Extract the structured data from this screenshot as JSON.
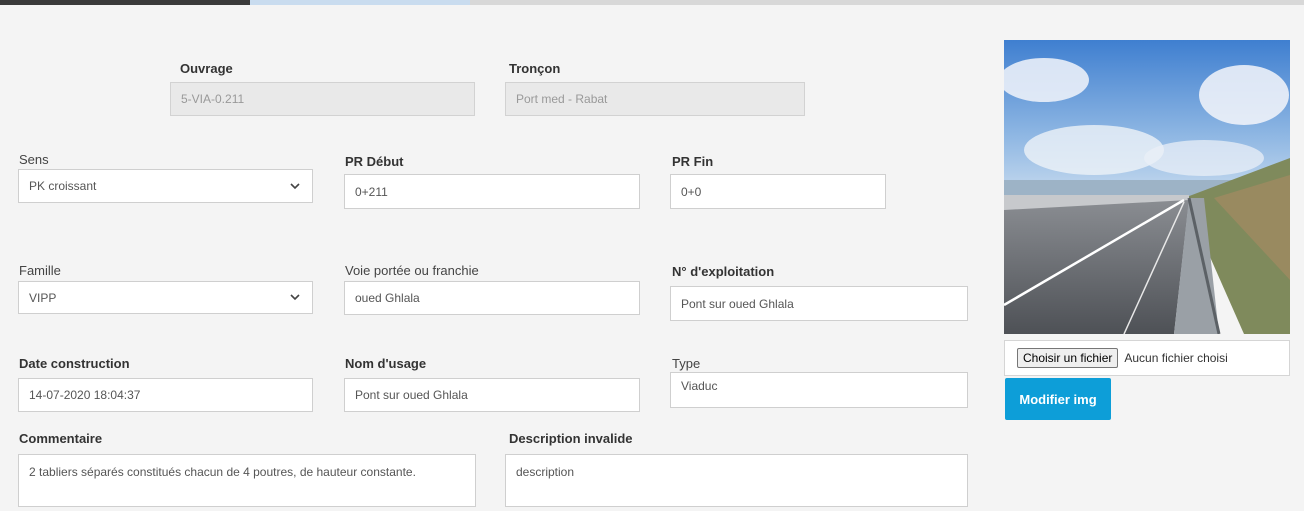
{
  "form": {
    "ouvrage": {
      "label": "Ouvrage",
      "value": "5-VIA-0.211"
    },
    "troncon": {
      "label": "Tronçon",
      "value": "Port med - Rabat"
    },
    "sens": {
      "label": "Sens",
      "value": "PK croissant"
    },
    "pr_debut": {
      "label": "PR Début",
      "value": "0+211"
    },
    "pr_fin": {
      "label": "PR Fin",
      "value": "0+0"
    },
    "famille": {
      "label": "Famille",
      "value": "VIPP"
    },
    "voie": {
      "label": "Voie portée ou franchie",
      "value": "oued Ghlala"
    },
    "n_exploitation": {
      "label": "N° d'exploitation",
      "value": "Pont sur oued Ghlala"
    },
    "date_construction": {
      "label": "Date construction",
      "value": "14-07-2020 18:04:37"
    },
    "nom_usage": {
      "label": "Nom d'usage",
      "value": "Pont sur oued Ghlala"
    },
    "type": {
      "label": "Type",
      "value": "Viaduc"
    },
    "commentaire": {
      "label": "Commentaire",
      "value": "2 tabliers séparés constitués chacun de 4 poutres, de hauteur constante."
    },
    "description": {
      "label": "Description invalide",
      "value": "description"
    }
  },
  "image_panel": {
    "file_button": "Choisir un fichier",
    "file_status": "Aucun fichier choisi",
    "modify_button": "Modifier img"
  },
  "colors": {
    "accent": "#0d9ed8",
    "readonly_bg": "#e9e9e9",
    "page_bg": "#f4f4f4"
  }
}
